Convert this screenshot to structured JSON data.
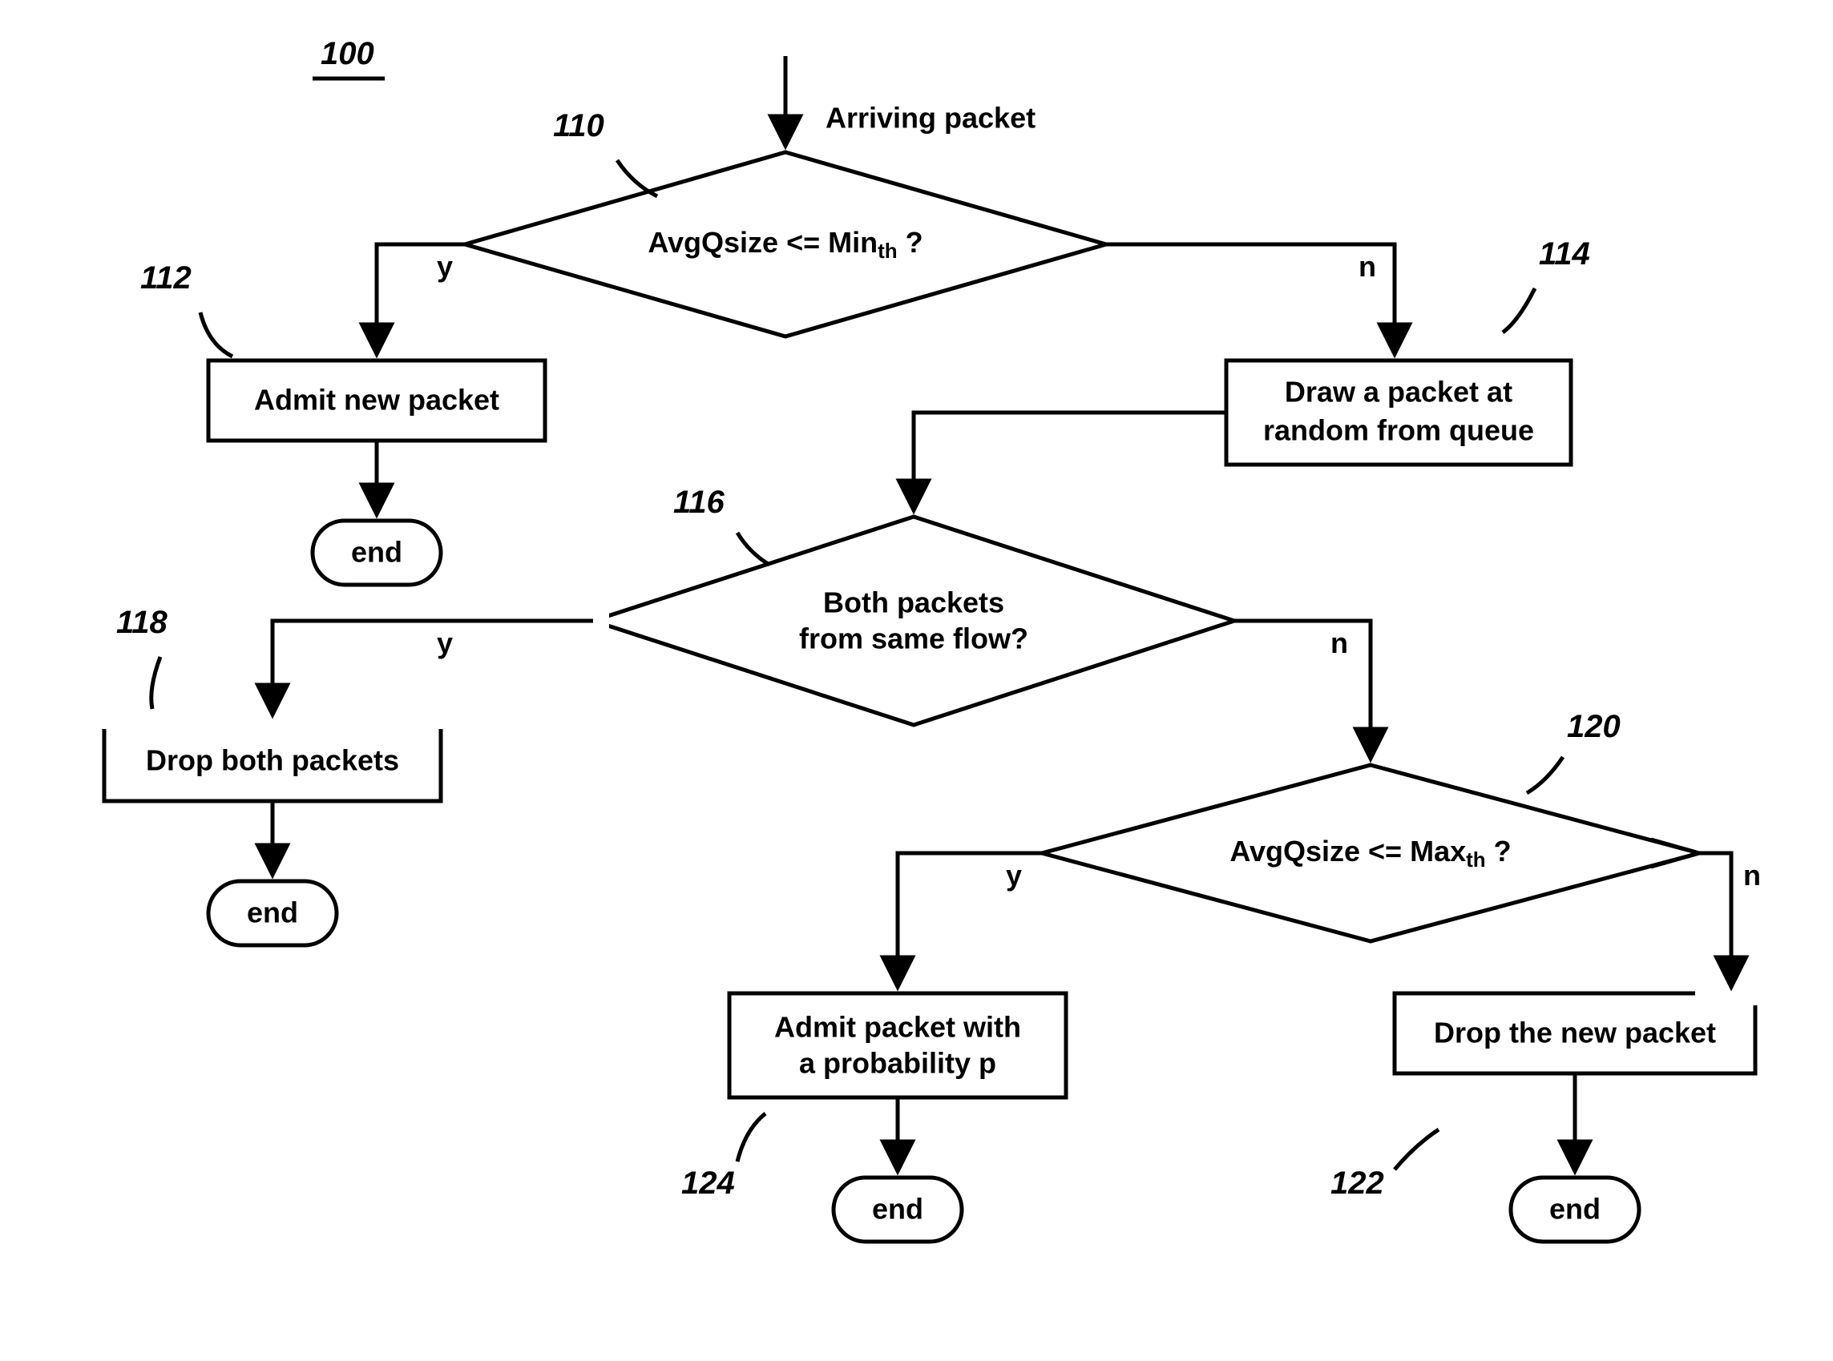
{
  "figure_id": "100",
  "start_label": "Arriving packet",
  "nodes": {
    "n110": {
      "ref": "110",
      "text_prefix": "AvgQsize <= Min",
      "text_sub": "th",
      "text_suffix": " ?"
    },
    "n112": {
      "ref": "112",
      "text": "Admit new packet"
    },
    "n114": {
      "ref": "114",
      "line1": "Draw a packet at",
      "line2": "random from queue"
    },
    "n116": {
      "ref": "116",
      "line1": "Both packets",
      "line2": "from same flow?"
    },
    "n118": {
      "ref": "118",
      "text": "Drop both packets"
    },
    "n120": {
      "ref": "120",
      "text_prefix": "AvgQsize <= Max",
      "text_sub": "th",
      "text_suffix": " ?"
    },
    "n122": {
      "ref": "122",
      "text": "Drop the new packet"
    },
    "n124": {
      "ref": "124",
      "line1": "Admit packet with",
      "line2": "a probability p"
    }
  },
  "terminator": "end",
  "edge_labels": {
    "yes": "y",
    "no": "n"
  }
}
